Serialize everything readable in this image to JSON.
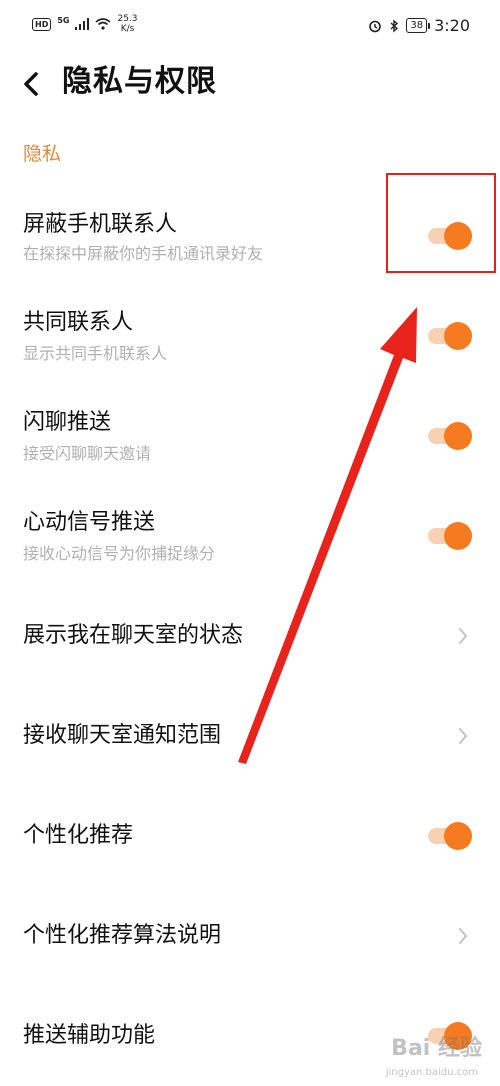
{
  "status_bar": {
    "hd": "HD",
    "network": "5G",
    "speed_value": "25.3",
    "speed_unit": "K/s",
    "battery": "38",
    "time": "3:20"
  },
  "header": {
    "title": "隐私与权限"
  },
  "section": {
    "label": "隐私"
  },
  "rows": [
    {
      "title": "屏蔽手机联系人",
      "subtitle": "在探探中屏蔽你的手机通讯录好友",
      "control": "switch",
      "on": true
    },
    {
      "title": "共同联系人",
      "subtitle": "显示共同手机联系人",
      "control": "switch",
      "on": true
    },
    {
      "title": "闪聊推送",
      "subtitle": "接受闪聊聊天邀请",
      "control": "switch",
      "on": true
    },
    {
      "title": "心动信号推送",
      "subtitle": "接收心动信号为你捕捉缘分",
      "control": "switch",
      "on": true
    },
    {
      "title": "展示我在聊天室的状态",
      "control": "chevron"
    },
    {
      "title": "接收聊天室通知范围",
      "control": "chevron"
    },
    {
      "title": "个性化推荐",
      "control": "switch",
      "on": true
    },
    {
      "title": "个性化推荐算法说明",
      "control": "chevron"
    },
    {
      "title": "推送辅助功能",
      "control": "switch",
      "on": true
    }
  ],
  "colors": {
    "accent": "#f67a1f",
    "accent_track": "#f8d1b3",
    "section_label": "#e08a3c",
    "subtitle": "#b0b0b0",
    "annotation": "#e2231a"
  },
  "watermark": {
    "text": "Bai 经验",
    "sub": "jingyan.baidu.com"
  }
}
